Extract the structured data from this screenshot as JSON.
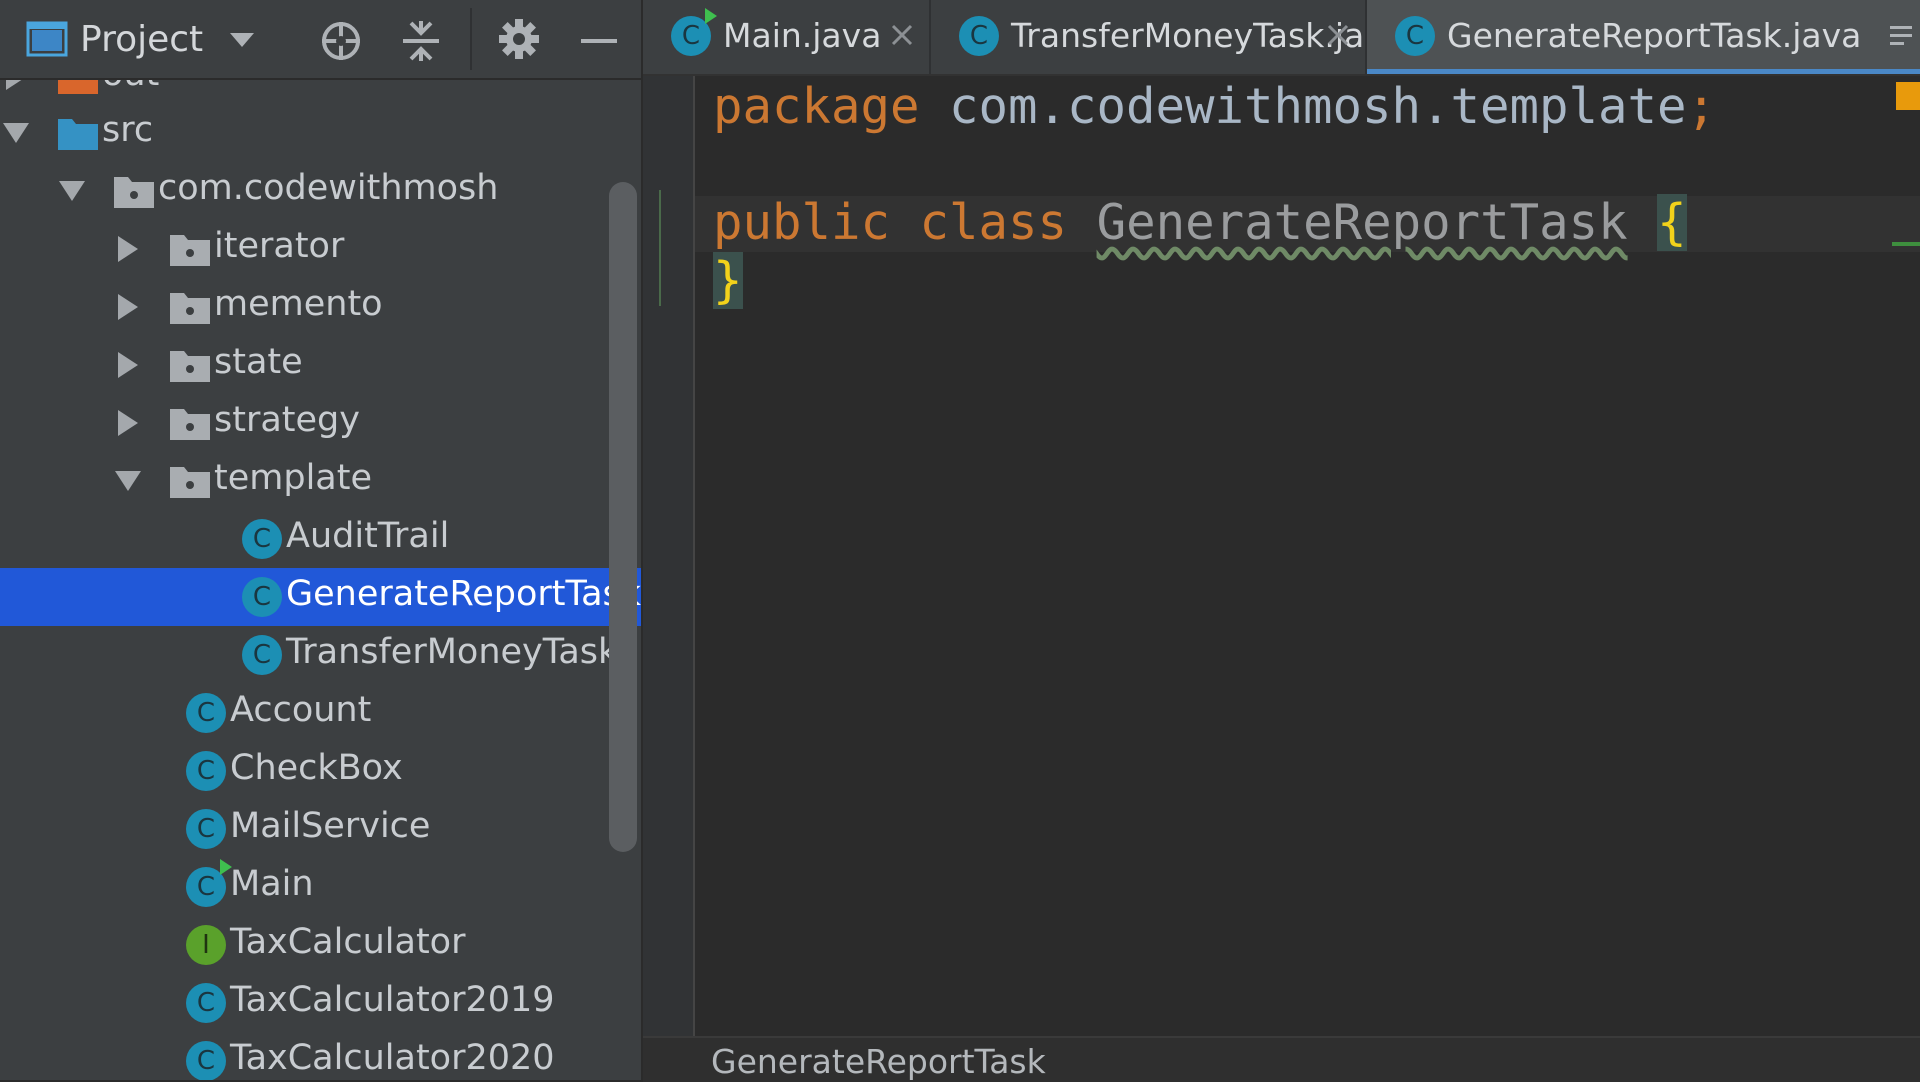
{
  "project_panel": {
    "title": "Project",
    "tree": [
      {
        "label": "out",
        "kind": "folder-excluded",
        "state": "collapsed"
      },
      {
        "label": "src",
        "kind": "folder-source",
        "state": "expanded"
      },
      {
        "label": "com.codewithmosh",
        "kind": "package",
        "state": "expanded"
      },
      {
        "label": "iterator",
        "kind": "package",
        "state": "collapsed"
      },
      {
        "label": "memento",
        "kind": "package",
        "state": "collapsed"
      },
      {
        "label": "state",
        "kind": "package",
        "state": "collapsed"
      },
      {
        "label": "strategy",
        "kind": "package",
        "state": "collapsed"
      },
      {
        "label": "template",
        "kind": "package",
        "state": "expanded"
      },
      {
        "label": "AuditTrail",
        "kind": "class",
        "badge": "C"
      },
      {
        "label": "GenerateReportTask",
        "kind": "class",
        "badge": "C",
        "selected": true
      },
      {
        "label": "TransferMoneyTask",
        "kind": "class",
        "badge": "C"
      },
      {
        "label": "Account",
        "kind": "class",
        "badge": "C"
      },
      {
        "label": "CheckBox",
        "kind": "class",
        "badge": "C"
      },
      {
        "label": "MailService",
        "kind": "class",
        "badge": "C"
      },
      {
        "label": "Main",
        "kind": "class-runnable",
        "badge": "C"
      },
      {
        "label": "TaxCalculator",
        "kind": "interface",
        "badge": "I"
      },
      {
        "label": "TaxCalculator2019",
        "kind": "class",
        "badge": "C"
      },
      {
        "label": "TaxCalculator2020",
        "kind": "class",
        "badge": "C"
      }
    ]
  },
  "editor": {
    "tabs": [
      {
        "label": "Main.java",
        "badge": "C",
        "runnable": true,
        "active": false
      },
      {
        "label": "TransferMoneyTask.java",
        "badge": "C",
        "runnable": false,
        "active": false
      },
      {
        "label": "GenerateReportTask.java",
        "badge": "C",
        "runnable": false,
        "active": true
      }
    ],
    "code": {
      "line1": {
        "kw": "package",
        "pkg": "com.codewithmosh.template",
        "semi": ";"
      },
      "line3": {
        "kw1": "public",
        "kw2": "class",
        "name": "GenerateReportTask",
        "brace": "{"
      },
      "line4": {
        "brace": "}"
      }
    },
    "breadcrumb": "GenerateReportTask"
  },
  "colors": {
    "selection": "#2158d8",
    "keyword": "#cc7832",
    "brace": "#f2d21b",
    "class_badge": "#1c8fb4",
    "interface_badge": "#5aa12b"
  }
}
